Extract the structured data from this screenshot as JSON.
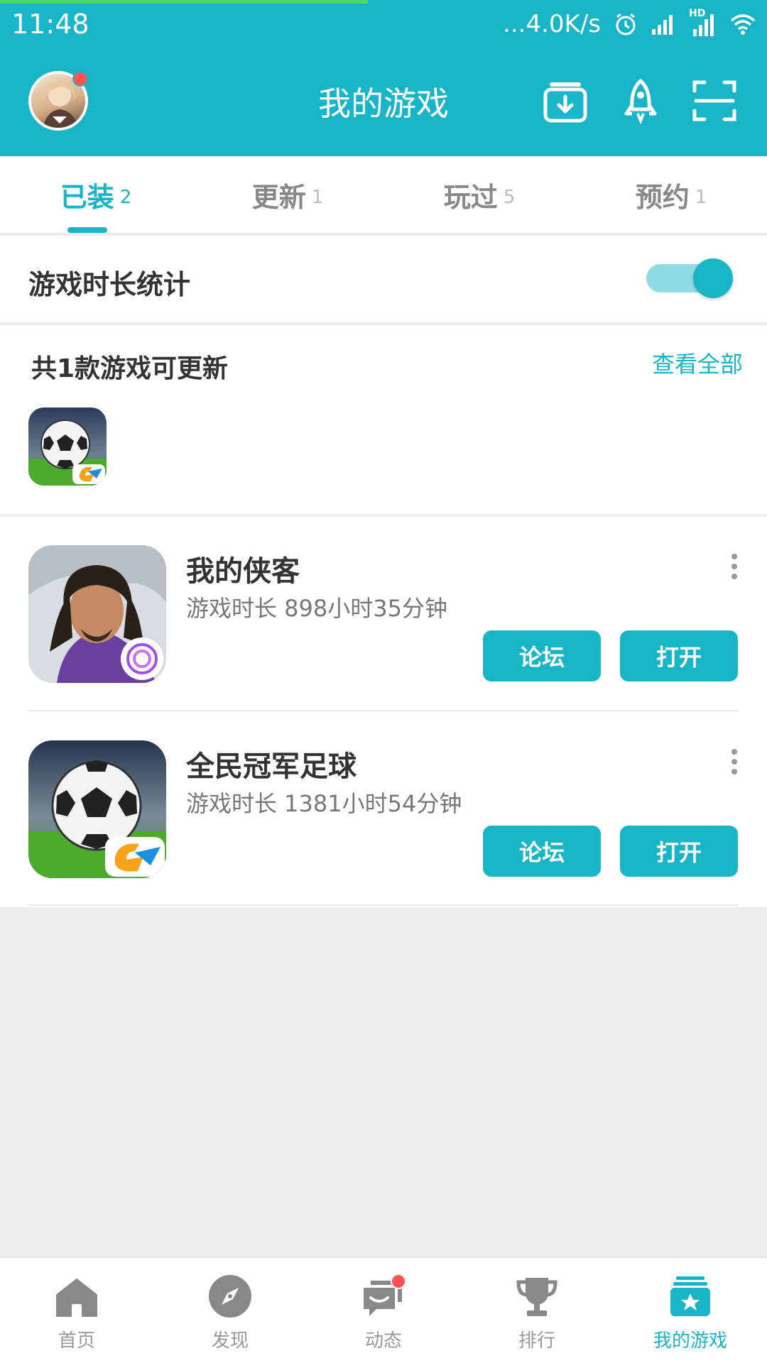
{
  "status_bar": {
    "time": "11:48",
    "network_speed": "...4.0K/s",
    "hd_label": "HD"
  },
  "header": {
    "title": "我的游戏"
  },
  "tabs": [
    {
      "label": "已装",
      "count": "2",
      "active": true
    },
    {
      "label": "更新",
      "count": "1",
      "active": false
    },
    {
      "label": "玩过",
      "count": "5",
      "active": false
    },
    {
      "label": "预约",
      "count": "1",
      "active": false
    }
  ],
  "playtime_stats": {
    "label": "游戏时长统计",
    "enabled": true
  },
  "updates": {
    "title": "共1款游戏可更新",
    "view_all": "查看全部"
  },
  "games": [
    {
      "name": "我的侠客",
      "playtime": "游戏时长 898小时35分钟",
      "forum_label": "论坛",
      "open_label": "打开"
    },
    {
      "name": "全民冠军足球",
      "playtime": "游戏时长 1381小时54分钟",
      "forum_label": "论坛",
      "open_label": "打开"
    }
  ],
  "bottom_nav": [
    {
      "label": "首页",
      "icon": "home-icon"
    },
    {
      "label": "发现",
      "icon": "compass-icon"
    },
    {
      "label": "动态",
      "icon": "chat-icon",
      "badge": true
    },
    {
      "label": "排行",
      "icon": "trophy-icon"
    },
    {
      "label": "我的游戏",
      "icon": "my-games-icon",
      "active": true
    }
  ],
  "colors": {
    "accent": "#17b5c7",
    "badge": "#ff5252",
    "background": "#ededed"
  }
}
